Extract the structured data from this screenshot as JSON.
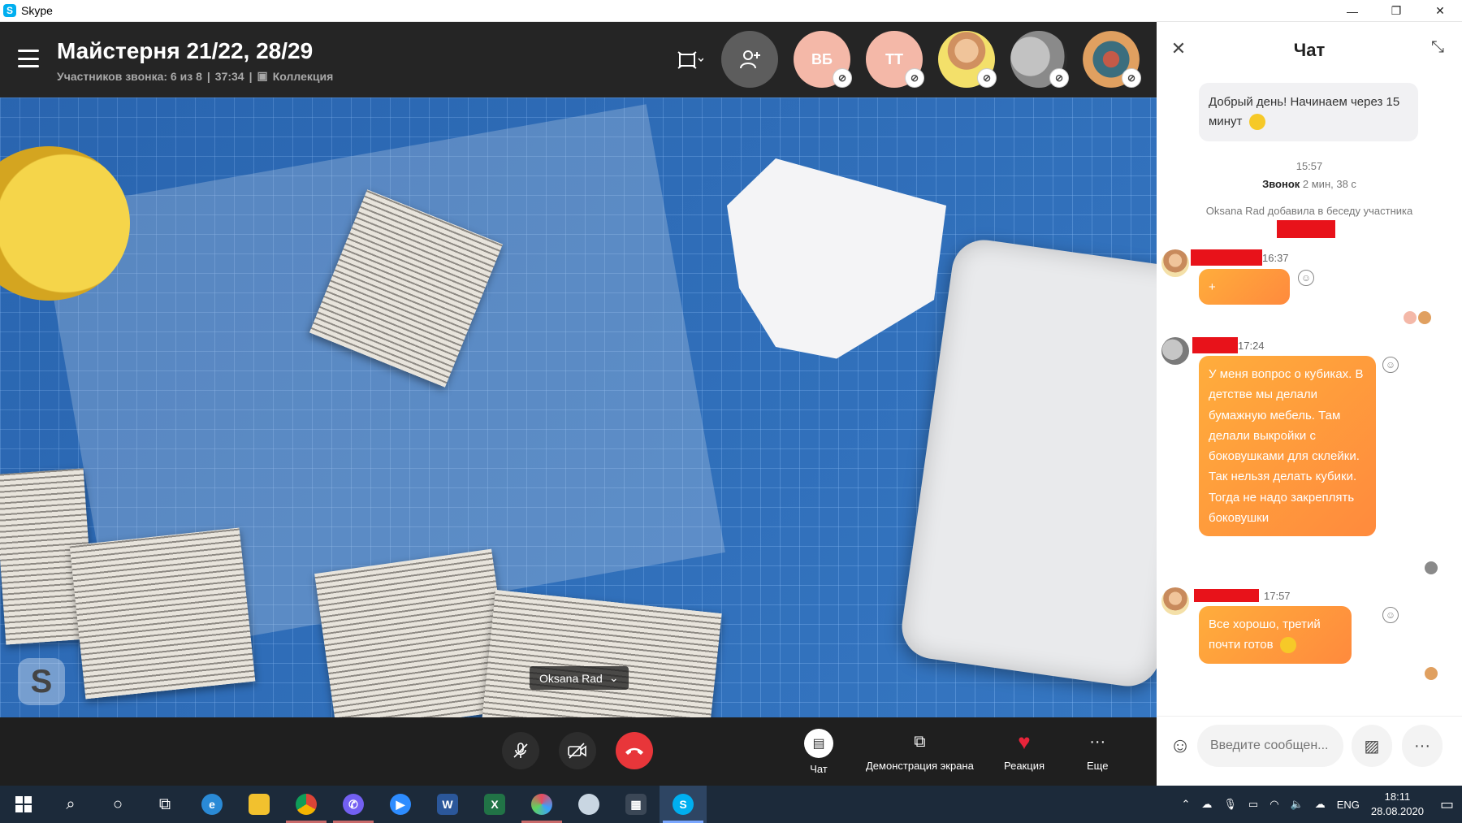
{
  "window": {
    "title": "Skype",
    "minimize": "—",
    "restore": "❐",
    "close": "✕"
  },
  "call": {
    "title": "Майстерня 21/22, 28/29",
    "participants": "Участников звонка: 6 из 8",
    "separator": "|",
    "duration": "37:34",
    "collection": "Коллекция",
    "participant_initials": [
      "ВБ",
      "ТТ"
    ],
    "speaker_name": "Oksana Rad"
  },
  "controls": {
    "chat": "Чат",
    "share": "Демонстрация экрана",
    "reaction": "Реакция",
    "more": "Еще"
  },
  "chat": {
    "title": "Чат",
    "first_message": "Добрый день! Начинаем через 15 минут",
    "time_1": "15:57",
    "call_label": "Звонок",
    "call_duration": "2 мин, 38 с",
    "added_notice": "Oksana Rad добавила в беседу участника",
    "msg2_time": "16:37",
    "msg2_text": "+",
    "msg3_time": "17:24",
    "msg3_text": "У меня вопрос о кубиках. В детстве мы делали бумажную мебель. Там делали выкройки с боковушками для склейки. Так нельзя делать кубики. Тогда не надо закреплять боковушки",
    "msg4_time": "17:57",
    "msg4_text": "Все хорошо, третий почти готов",
    "input_placeholder": "Введите сообщен..."
  },
  "taskbar": {
    "lang": "ENG",
    "time": "18:11",
    "date": "28.08.2020"
  },
  "colors": {
    "accent": "#00aff0",
    "end_call": "#e8363a",
    "message_orange": "#ff9a3c"
  }
}
